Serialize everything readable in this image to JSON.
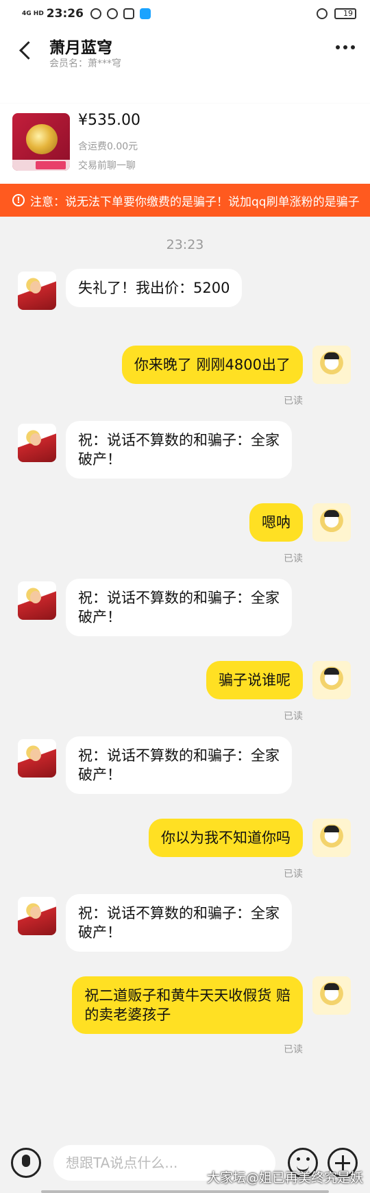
{
  "status_bar": {
    "network": "4G HD",
    "time": "23:26",
    "battery": "19"
  },
  "header": {
    "title": "萧月蓝穹",
    "member_label": "会员名：萧***穹"
  },
  "product": {
    "price": "¥535.00",
    "shipping": "含运费0.00元",
    "chat_prompt": "交易前聊一聊"
  },
  "warning": {
    "text": "注意：说无法下单要你缴费的是骗子！说加qq刷单涨粉的是骗子"
  },
  "chat": {
    "timestamp": "23:23",
    "read_label": "已读",
    "messages": [
      {
        "side": "in",
        "text": "失礼了！我出价：5200"
      },
      {
        "side": "out",
        "text": "你来晚了 刚刚4800出了"
      },
      {
        "side": "in",
        "text": "祝：说话不算数的和骗子：全家\n破产！"
      },
      {
        "side": "out",
        "text": "嗯呐"
      },
      {
        "side": "in",
        "text": "祝：说话不算数的和骗子：全家\n破产！"
      },
      {
        "side": "out",
        "text": "骗子说谁呢"
      },
      {
        "side": "in",
        "text": "祝：说话不算数的和骗子：全家\n破产！"
      },
      {
        "side": "out",
        "text": "你以为我不知道你吗"
      },
      {
        "side": "in",
        "text": "祝：说话不算数的和骗子：全家\n破产！"
      },
      {
        "side": "out",
        "text": "祝二道贩子和黄牛天天收假货 赔\n的卖老婆孩子"
      }
    ]
  },
  "input_bar": {
    "placeholder": "想跟TA说点什么..."
  },
  "watermark": "大家坛@姐已再美终究是妖"
}
